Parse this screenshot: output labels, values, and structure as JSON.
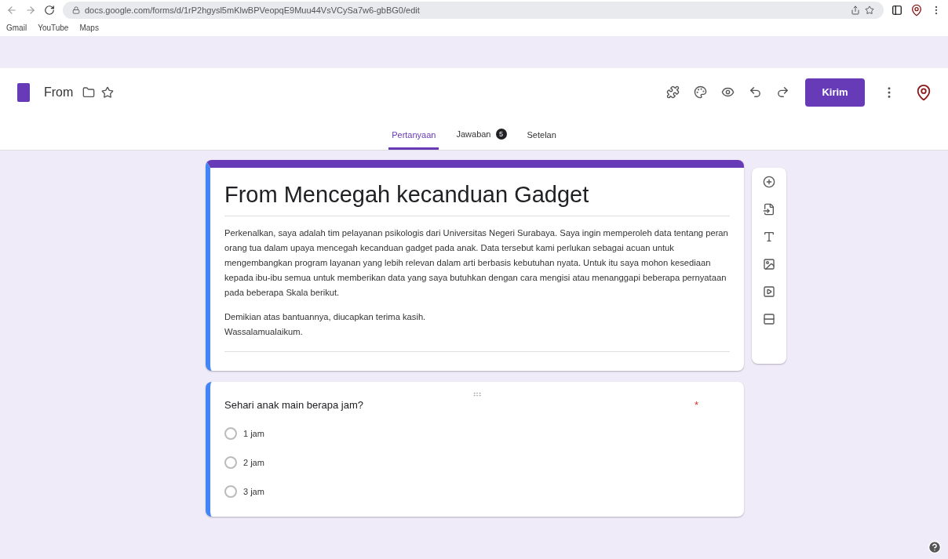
{
  "browser": {
    "url": "docs.google.com/forms/d/1rP2hgysl5mKlwBPVeopqE9Muu44VsVCySa7w6-gbBG0/edit",
    "bookmarks": [
      "Gmail",
      "YouTube",
      "Maps"
    ]
  },
  "app": {
    "doc_title": "From",
    "send_button": "Kirim"
  },
  "tabs": [
    {
      "label": "Pertanyaan",
      "selected": true
    },
    {
      "label": "Jawaban",
      "selected": false,
      "badge": "5"
    },
    {
      "label": "Setelan",
      "selected": false
    }
  ],
  "form": {
    "title": "From Mencegah kecanduan Gadget",
    "description": [
      "Perkenalkan, saya adalah tim pelayanan psikologis dari Universitas Negeri Surabaya. Saya ingin memperoleh data tentang peran orang tua dalam upaya mencegah kecanduan gadget pada anak. Data tersebut kami perlukan sebagai acuan untuk mengembangkan program layanan yang lebih relevan dalam arti berbasis kebutuhan nyata. Untuk itu saya mohon kesediaan kepada ibu-ibu semua untuk memberikan data yang saya butuhkan dengan cara mengisi atau menanggapi beberapa pernyataan pada beberapa Skala berikut.",
      "Demikian atas bantuannya, diucapkan terima kasih.\nWassalamualaikum."
    ]
  },
  "question": {
    "text": "Sehari anak main berapa jam?",
    "required_mark": "*",
    "options": [
      {
        "label": "1 jam",
        "selected": false
      },
      {
        "label": "2 jam",
        "selected": false
      },
      {
        "label": "3 jam",
        "selected": false
      }
    ]
  }
}
